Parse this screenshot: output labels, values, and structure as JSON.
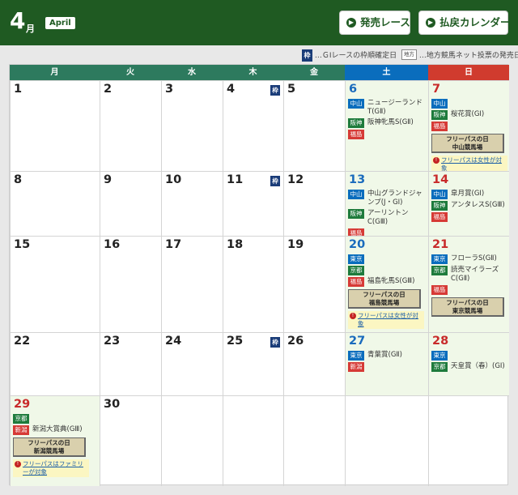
{
  "header": {
    "month_number": "4",
    "month_unit": "月",
    "month_en": "April",
    "buttons": [
      {
        "label": "発売レース"
      },
      {
        "label": "払戻カレンダー"
      }
    ]
  },
  "legend": {
    "frame_badge": "枠",
    "frame_text": "…ＧⅠレースの枠順確定日",
    "chiho_badge": "地方",
    "chiho_text": "…地方競馬ネット投票の発売日"
  },
  "calendar": {
    "weekdays": [
      "月",
      "火",
      "水",
      "木",
      "金",
      "土",
      "日"
    ],
    "days": [
      {
        "num": "1"
      },
      {
        "num": "2"
      },
      {
        "num": "3"
      },
      {
        "num": "4",
        "frame": "枠"
      },
      {
        "num": "5"
      },
      {
        "num": "6",
        "races": [
          {
            "venue": "中山",
            "name": "ニュージーランドT(GⅡ)"
          },
          {
            "venue": "阪神",
            "name": "阪神牝馬S(GⅡ)"
          },
          {
            "venue": "福島",
            "name": ""
          }
        ]
      },
      {
        "num": "7",
        "races": [
          {
            "venue": "中山",
            "name": ""
          },
          {
            "venue": "阪神",
            "name": "桜花賞(GⅠ)"
          },
          {
            "venue": "福島",
            "name": ""
          }
        ],
        "freepass": [
          "フリーパスの日",
          "中山競馬場"
        ],
        "note": "フリーパスは女性が対象"
      },
      {
        "num": "8"
      },
      {
        "num": "9"
      },
      {
        "num": "10"
      },
      {
        "num": "11",
        "frame": "枠"
      },
      {
        "num": "12"
      },
      {
        "num": "13",
        "races": [
          {
            "venue": "中山",
            "name": "中山グランドジャンプ(J・GⅠ)"
          },
          {
            "venue": "阪神",
            "name": "アーリントンC(GⅢ)"
          },
          {
            "venue": "福島",
            "name": ""
          }
        ]
      },
      {
        "num": "14",
        "races": [
          {
            "venue": "中山",
            "name": "皐月賞(GⅠ)"
          },
          {
            "venue": "阪神",
            "name": "アンタレスS(GⅢ)"
          },
          {
            "venue": "福島",
            "name": ""
          }
        ]
      },
      {
        "num": "15"
      },
      {
        "num": "16"
      },
      {
        "num": "17"
      },
      {
        "num": "18"
      },
      {
        "num": "19"
      },
      {
        "num": "20",
        "races": [
          {
            "venue": "東京",
            "name": ""
          },
          {
            "venue": "京都",
            "name": ""
          },
          {
            "venue": "福島",
            "name": "福島牝馬S(GⅢ)"
          }
        ],
        "freepass": [
          "フリーパスの日",
          "福島競馬場"
        ],
        "note": "フリーパスは女性が対象"
      },
      {
        "num": "21",
        "races": [
          {
            "venue": "東京",
            "name": "フローラS(GⅡ)"
          },
          {
            "venue": "京都",
            "name": "読売マイラーズC(GⅡ)"
          },
          {
            "venue": "福島",
            "name": ""
          }
        ],
        "freepass": [
          "フリーパスの日",
          "東京競馬場"
        ]
      },
      {
        "num": "22"
      },
      {
        "num": "23"
      },
      {
        "num": "24"
      },
      {
        "num": "25",
        "frame": "枠"
      },
      {
        "num": "26"
      },
      {
        "num": "27",
        "races": [
          {
            "venue": "東京",
            "name": "青葉賞(GⅡ)"
          },
          {
            "venue": "新潟",
            "name": ""
          }
        ]
      },
      {
        "num": "28",
        "races": [
          {
            "venue": "東京",
            "name": ""
          },
          {
            "venue": "京都",
            "name": "天皇賞（春）(GⅠ)"
          }
        ]
      },
      {
        "num": "29",
        "races": [
          {
            "venue": "京都",
            "name": ""
          },
          {
            "venue": "新潟",
            "name": "新潟大賞典(GⅢ)"
          }
        ],
        "freepass": [
          "フリーパスの日",
          "新潟競馬場"
        ],
        "note": "フリーパスはファミリーが対象"
      },
      {
        "num": "30"
      }
    ]
  },
  "colors": {
    "header_bg": "#1f5a22",
    "weekday_header": "#2d7a5e",
    "saturday": "#0a6dbd",
    "sunday": "#d03b2e",
    "weekend_cell": "#f0f8e8",
    "venue_blue": "#0a6dbd",
    "venue_green": "#1e7b3c",
    "venue_red": "#d63a36"
  }
}
